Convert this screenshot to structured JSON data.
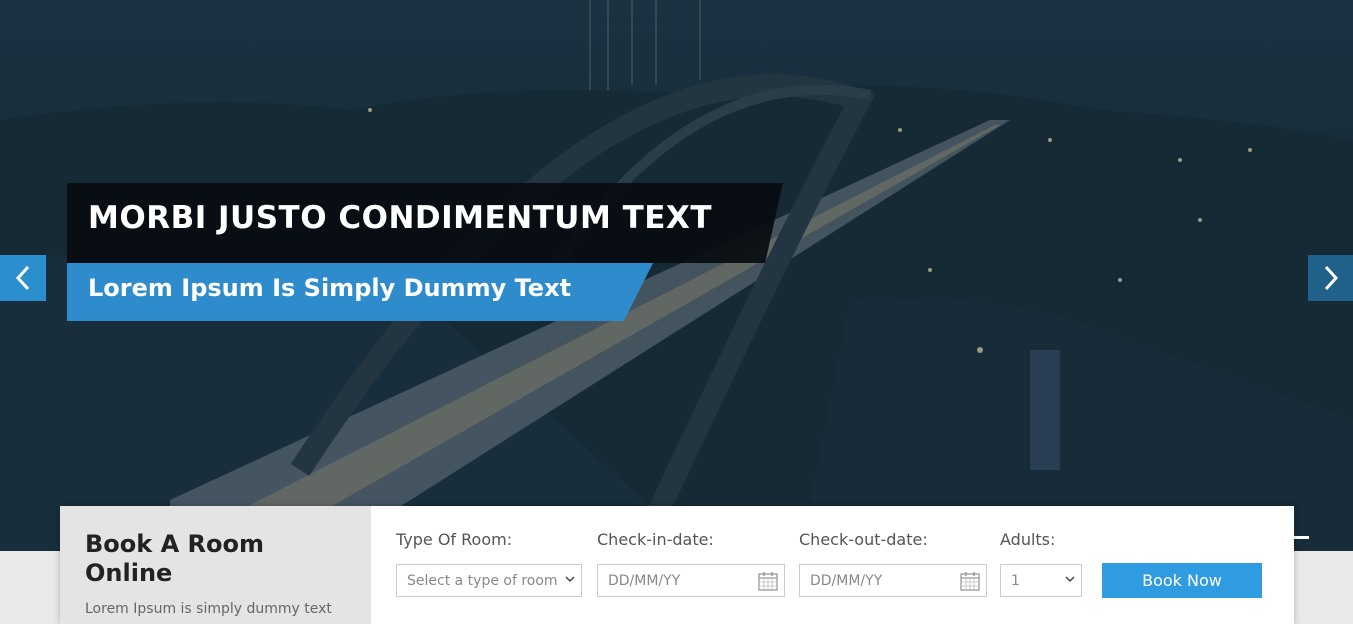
{
  "hero": {
    "title": "MORBI JUSTO CONDIMENTUM TEXT",
    "subtitle": "Lorem Ipsum Is Simply Dummy Text",
    "prev_icon": "chevron-left-icon",
    "next_icon": "chevron-right-icon"
  },
  "booking": {
    "title": "Book A Room Online",
    "description": "Lorem Ipsum is simply dummy text",
    "room_type": {
      "label": "Type Of Room:",
      "value": "Select a type of room"
    },
    "checkin": {
      "label": "Check-in-date:",
      "placeholder": "DD/MM/YY"
    },
    "checkout": {
      "label": "Check-out-date:",
      "placeholder": "DD/MM/YY"
    },
    "adults": {
      "label": "Adults:",
      "value": "1"
    },
    "button": "Book Now"
  },
  "colors": {
    "accent": "#2f8ccc",
    "button": "#2f9be0",
    "overlay": "#0a0e12"
  }
}
